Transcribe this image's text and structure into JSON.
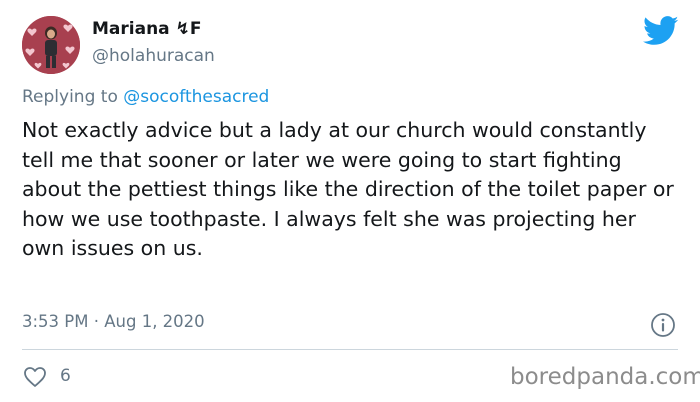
{
  "user": {
    "display_name": "Mariana ⸻F",
    "name_text": "Mariana",
    "name_badge": "↯",
    "name_suffix": "F",
    "handle": "@holahuracan"
  },
  "reply": {
    "prefix": "Replying to ",
    "mention": "@socofthesacred"
  },
  "tweet": {
    "text": "Not exactly advice but a lady at our church would constantly tell me that sooner or later we were going to start fighting about the pettiest things like the direction of the toilet paper or how we use toothpaste. I always felt she was projecting her own issues on us.",
    "time": "3:53 PM",
    "separator": "·",
    "date": "Aug 1, 2020"
  },
  "engagement": {
    "likes": "6"
  },
  "watermark": "boredpanda.com",
  "icons": {
    "platform": "twitter-bird-icon",
    "info": "info-icon",
    "like": "heart-icon"
  },
  "colors": {
    "brand_blue": "#1da1f2",
    "mention_blue": "#1b95e0",
    "muted_gray": "#657786",
    "text": "#14171a",
    "avatar_bg": "#a8404f"
  }
}
